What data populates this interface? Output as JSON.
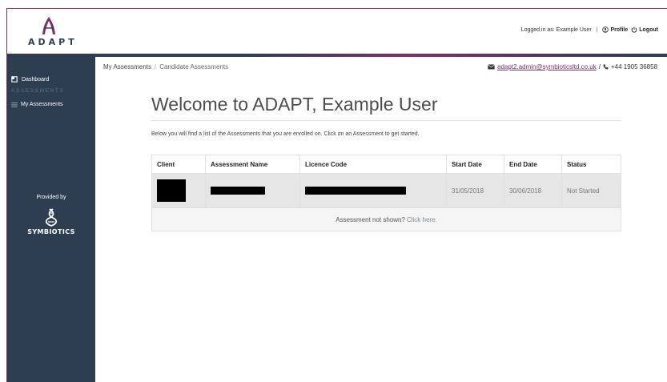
{
  "header": {
    "logo_text": "ADAPT",
    "logged_in": "Logged in as: Example User",
    "profile_label": "Profile",
    "logout_label": "Logout"
  },
  "sidebar": {
    "dashboard": "Dashboard",
    "section_label": "ASSESSMENTS",
    "my_assessments": "My Assessments",
    "provided_by": "Provided by",
    "provider_name": "SYMBIOTICS"
  },
  "breadcrumb": {
    "items": [
      "My Assessments",
      "Candidate Assessments"
    ]
  },
  "contact": {
    "email": "adapt2.admin@symbioticsltd.co.uk",
    "sep": "/",
    "phone": "+44 1905 36858"
  },
  "main": {
    "title": "Welcome to ADAPT, Example User",
    "intro": "Below you will find a list of the Assessments that you are enrolled on. Click on an Assessment to get started."
  },
  "table": {
    "headers": [
      "Client",
      "Assessment Name",
      "Licence Code",
      "Start Date",
      "End Date",
      "Status"
    ],
    "rows": [
      {
        "start_date": "31/05/2018",
        "end_date": "30/06/2018",
        "status": "Not Started"
      }
    ],
    "footer_text": "Assessment not shown?",
    "footer_link": "Click here."
  },
  "colors": {
    "sidebar_bg": "#2c3e50",
    "brand_accent": "#7b2e6e",
    "row_bg": "#e6e6e6"
  }
}
